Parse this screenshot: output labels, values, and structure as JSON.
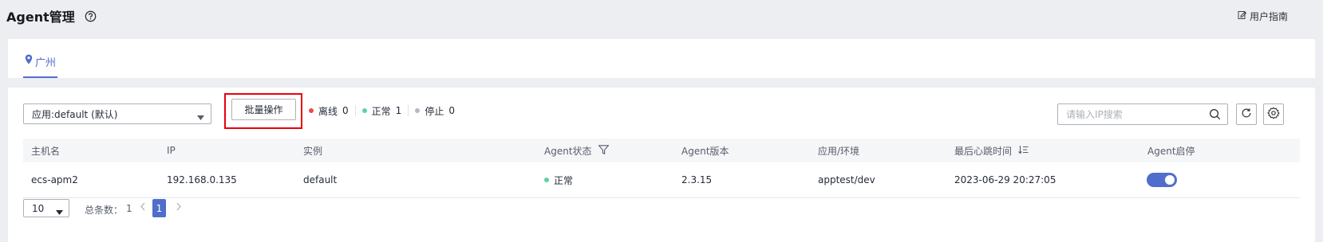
{
  "header": {
    "title": "Agent管理",
    "help_icon": "question-circle-icon",
    "guide_label": "用户指南",
    "guide_icon": "edit-doc-icon"
  },
  "region_tab": {
    "label": "广州",
    "icon": "location-pin-icon"
  },
  "toolbar": {
    "app_select_value": "应用:default (默认)",
    "batch_label": "批量操作",
    "status": [
      {
        "label": "离线",
        "count": "0",
        "color": "#e84b4b"
      },
      {
        "label": "正常",
        "count": "1",
        "color": "#5fd0a8"
      },
      {
        "label": "停止",
        "count": "0",
        "color": "#b5b8bf"
      }
    ],
    "search_placeholder": "请输入IP搜索",
    "refresh_icon": "refresh-icon",
    "settings_icon": "gear-icon"
  },
  "table": {
    "columns": [
      "主机名",
      "IP",
      "实例",
      "Agent状态",
      "Agent版本",
      "应用/环境",
      "最后心跳时间",
      "Agent启停"
    ],
    "rows": [
      {
        "host": "ecs-apm2",
        "ip": "192.168.0.135",
        "instance": "default",
        "status": "正常",
        "status_color": "#5fd0a8",
        "version": "2.3.15",
        "app_env": "apptest/dev",
        "heartbeat": "2023-06-29 20:27:05",
        "enabled": true
      }
    ]
  },
  "pagination": {
    "page_size": "10",
    "total_label": "总条数：",
    "total_count": "1",
    "current_page": "1"
  },
  "colors": {
    "accent": "#526ecc",
    "highlight_border": "#e8000b"
  }
}
